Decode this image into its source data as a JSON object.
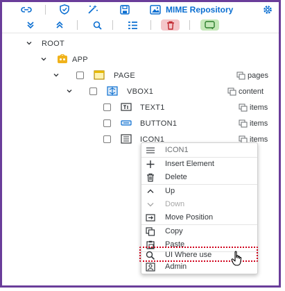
{
  "toolbar": {
    "mime_repository_label": "MIME Repository"
  },
  "tree": {
    "root": "ROOT",
    "app": "APP",
    "page": "PAGE",
    "page_agg": "pages",
    "vbox": "VBOX1",
    "vbox_agg": "content",
    "text1": "TEXT1",
    "text1_agg": "items",
    "button1": "BUTTON1",
    "button1_agg": "items",
    "icon1": "ICON1",
    "icon1_agg": "items"
  },
  "context_menu": {
    "header": "ICON1",
    "items": [
      {
        "label": "Insert Element",
        "icon": "plus-icon",
        "enabled": true
      },
      {
        "label": "Delete",
        "icon": "trash-icon",
        "enabled": true
      },
      {
        "label": "Up",
        "icon": "chevron-up-icon",
        "enabled": true
      },
      {
        "label": "Down",
        "icon": "chevron-down-icon",
        "enabled": false
      },
      {
        "label": "Move Position",
        "icon": "move-icon",
        "enabled": true
      },
      {
        "label": "Copy",
        "icon": "copy-icon",
        "enabled": true
      },
      {
        "label": "Paste",
        "icon": "paste-icon",
        "enabled": true
      },
      {
        "label": "UI Where use",
        "icon": "search-icon",
        "enabled": true
      },
      {
        "label": "Admin",
        "icon": "admin-icon",
        "enabled": true
      }
    ]
  },
  "colors": {
    "accent": "#0a6ed1",
    "frame": "#6a3d9a",
    "highlight": "#d0011b",
    "red_button": "#f4c6c9",
    "green_button": "#c5e8b9"
  }
}
